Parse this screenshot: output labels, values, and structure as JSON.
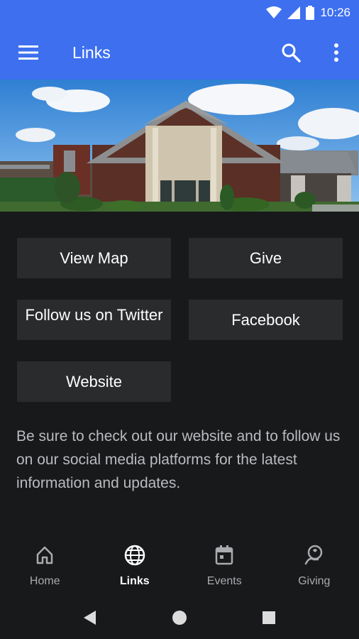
{
  "status": {
    "time": "10:26"
  },
  "appbar": {
    "title": "Links"
  },
  "buttons": [
    {
      "label": "View Map"
    },
    {
      "label": "Give"
    },
    {
      "label": "Follow us on Twitter"
    },
    {
      "label": "Facebook"
    },
    {
      "label": "Website"
    }
  ],
  "description": "Be sure to check out our website and to follow us on our social media platforms for the latest information and updates.",
  "bottom_nav": {
    "items": [
      {
        "label": "Home",
        "icon": "home-icon"
      },
      {
        "label": "Links",
        "icon": "globe-icon",
        "active": true
      },
      {
        "label": "Events",
        "icon": "calendar-icon"
      },
      {
        "label": "Giving",
        "icon": "giving-icon"
      }
    ]
  },
  "colors": {
    "accent": "#3d6fef",
    "background": "#18191b",
    "button": "#2a2b2d"
  }
}
